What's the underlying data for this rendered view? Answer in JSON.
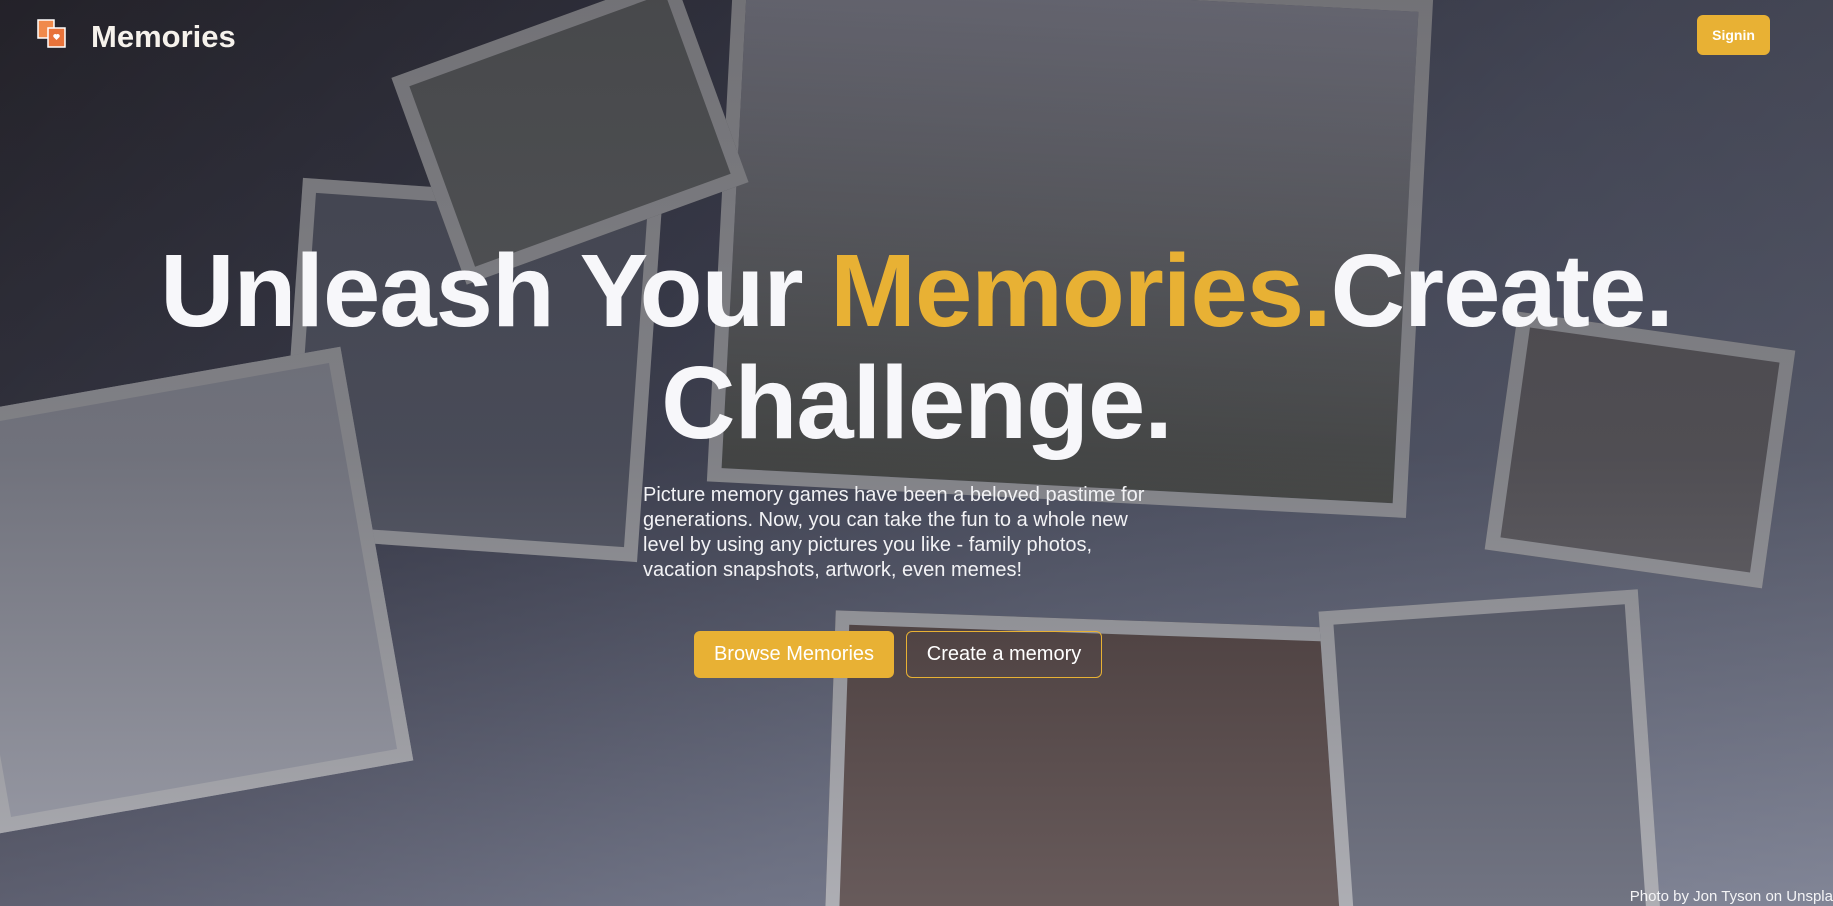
{
  "nav": {
    "brand": "Memories",
    "signin_label": "Signin"
  },
  "hero": {
    "line1_a": "Unleash Your ",
    "line1_accent": "Memories.",
    "line1_b": "Create.",
    "line2": "Challenge.",
    "description": "Picture memory games have been a beloved pastime for generations. Now, you can take the fun to a whole new level by using any pictures you like - family photos, vacation snapshots, artwork, even memes!",
    "browse_label": "Browse Memories",
    "create_label": "Create a memory"
  },
  "credit": "Photo by Jon Tyson on Unspla",
  "colors": {
    "accent": "#e8b134"
  }
}
